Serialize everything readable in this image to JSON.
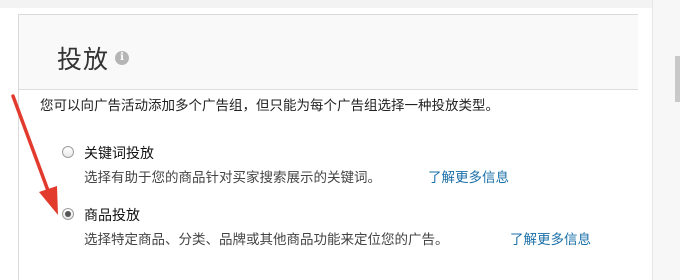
{
  "panel": {
    "title": "投放",
    "info_icon": "info-icon",
    "description": "您可以向广告活动添加多个广告组，但只能为每个广告组选择一种投放类型。"
  },
  "options": [
    {
      "label": "关键词投放",
      "help": "选择有助于您的商品针对买家搜索展示的关键词。",
      "link": "了解更多信息",
      "selected": false
    },
    {
      "label": "商品投放",
      "help": "选择特定商品、分类、品牌或其他商品功能来定位您的广告。",
      "link": "了解更多信息",
      "selected": true
    }
  ],
  "annotation": {
    "arrow_color": "#e23b2e"
  }
}
